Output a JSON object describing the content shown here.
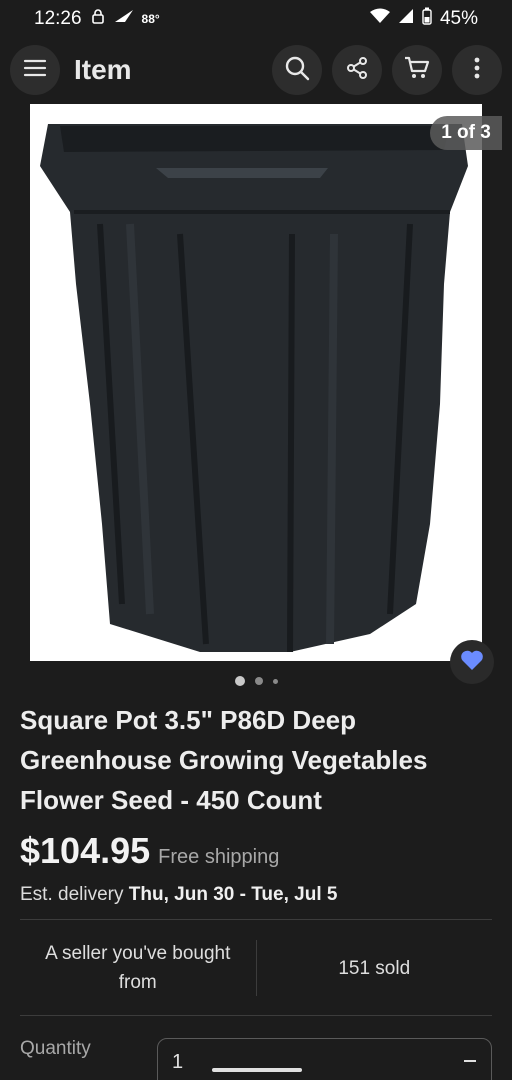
{
  "status_bar": {
    "time": "12:26",
    "temperature": "88°",
    "battery": "45%"
  },
  "app_bar": {
    "title": "Item",
    "icons": [
      "menu-icon",
      "search-icon",
      "share-icon",
      "cart-icon",
      "more-icon"
    ]
  },
  "gallery": {
    "counter": "1 of 3",
    "image_alt": "black square plastic pot",
    "favorite_icon": "heart-icon",
    "pages": 3,
    "current_page": 1
  },
  "listing": {
    "title": "Square Pot 3.5\" P86D Deep Greenhouse Growing Vegetables Flower Seed - 450 Count",
    "price": "$104.95",
    "shipping": "Free shipping",
    "delivery_label": "Est. delivery",
    "delivery_dates": "Thu, Jun 30 - Tue, Jul 5",
    "seller_note": "A seller you've bought from",
    "sold_count": "151 sold",
    "quantity_label": "Quantity",
    "quantity_value": "1"
  },
  "colors": {
    "background": "#1c1c1c",
    "favorite": "#6b8cff"
  }
}
